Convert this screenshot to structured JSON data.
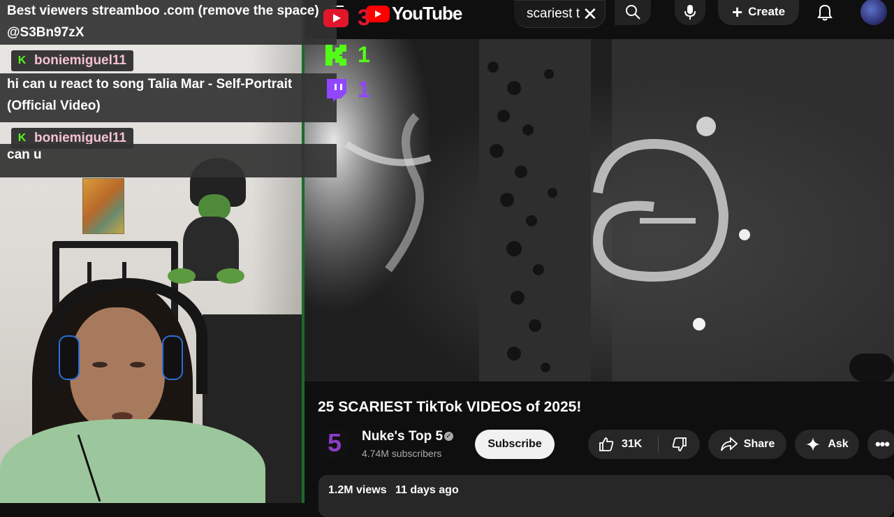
{
  "overlay": {
    "donation_text": "Best viewers streamboo .com (remove the space) @S3Bn97zX",
    "chat": [
      {
        "username": "boniemiguel11",
        "message": "hi can u react to song Talia Mar - Self-Portrait (Official Video)"
      },
      {
        "username": "boniemiguel11",
        "message": "can u"
      }
    ],
    "counters": {
      "youtube": "3",
      "kick": "1",
      "twitch": "1"
    },
    "colors": {
      "youtube": "#e0162b",
      "kick": "#53fc18",
      "twitch": "#9146ff"
    }
  },
  "youtube": {
    "logo_text": "YouTube",
    "search_value": "scariest t",
    "create_label": "Create",
    "video": {
      "title": "25 SCARIEST TikTok VIDEOS of 2025!",
      "channel_name": "Nuke's Top 5",
      "channel_logo_text": "5",
      "subscribers": "4.74M subscribers",
      "subscribe_label": "Subscribe",
      "likes": "31K",
      "share_label": "Share",
      "ask_label": "Ask",
      "more_label": "•••",
      "views": "1.2M views",
      "date": "11 days ago"
    },
    "icons": [
      "menu-icon",
      "youtube-play-icon",
      "search-icon",
      "close-icon",
      "mic-icon",
      "plus-icon",
      "bell-icon",
      "verified-icon",
      "thumbs-up-icon",
      "thumbs-down-icon",
      "share-icon",
      "sparkle-icon"
    ]
  }
}
